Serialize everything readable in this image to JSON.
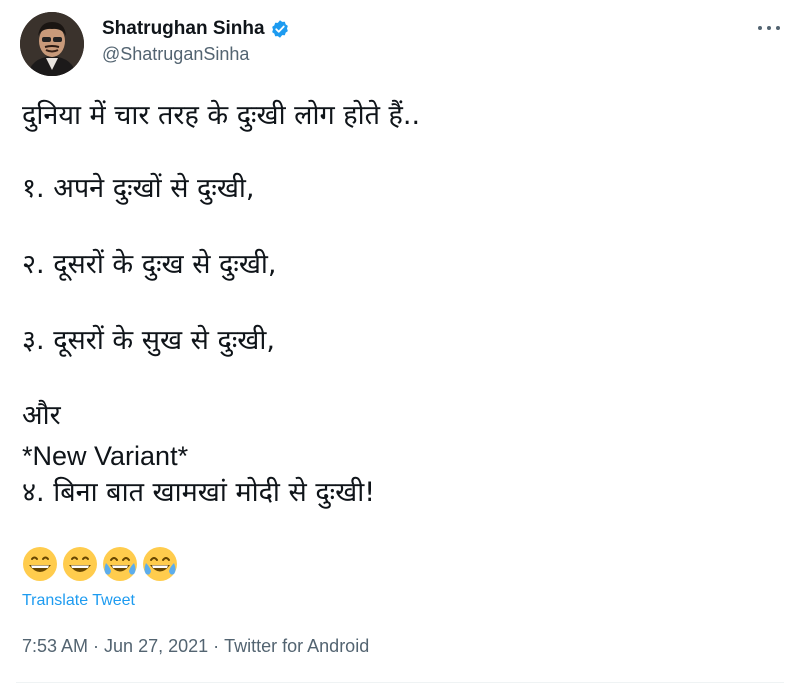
{
  "author": {
    "display_name": "Shatrughan Sinha",
    "handle": "@ShatruganSinha",
    "verified": true
  },
  "tweet": {
    "lines": [
      "दुनिया में चार तरह के दुःखी लोग होते हैं..",
      "१. अपने दुःखों से दुःखी,",
      "२. दूसरों के दुःख से दुःखी,",
      "३. दूसरों के सुख से दुःखी,",
      "और",
      "*New Variant*",
      "४. बिना बात खामखां मोदी से दुःखी!"
    ],
    "emojis": [
      "grinning-face-emoji",
      "grinning-face-emoji",
      "tears-of-joy-emoji",
      "tears-of-joy-emoji"
    ],
    "translate_label": "Translate Tweet",
    "time": "7:53 AM",
    "date": "Jun 27, 2021",
    "source": "Twitter for Android",
    "separator": "·"
  },
  "colors": {
    "text": "#0f1419",
    "secondary": "#536471",
    "link": "#1d9bf0",
    "verified": "#1d9bf0"
  }
}
